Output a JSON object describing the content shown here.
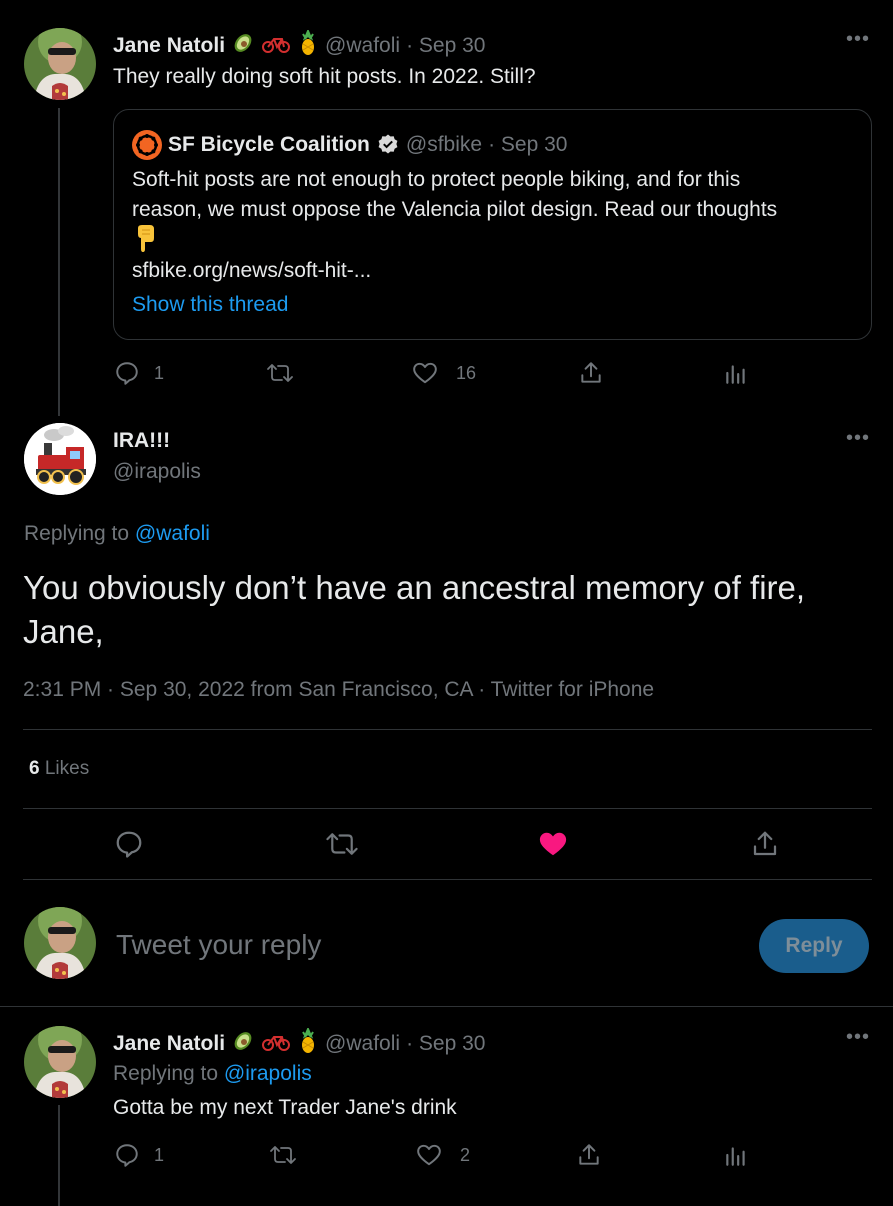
{
  "tweet1": {
    "name": "Jane Natoli",
    "handle": "@wafoli",
    "date": "· Sep 30",
    "text": "They really doing soft hit posts. In 2022. Still?",
    "quote": {
      "name": "SF Bicycle Coalition",
      "handle": "@sfbike",
      "date": "· Sep 30",
      "text_line1": "Soft-hit posts are not enough to protect people biking, and for this",
      "text_line2": "reason, we must oppose the Valencia pilot design. Read our thoughts",
      "link": "sfbike.org/news/soft-hit-...",
      "show_thread": "Show this thread"
    },
    "replies": "1",
    "likes": "16"
  },
  "main": {
    "name": "IRA!!!",
    "handle": "@irapolis",
    "replying_prefix": "Replying to ",
    "replying_handle": "@wafoli",
    "text_line1": "You obviously don’t have an ancestral memory of fire,",
    "text_line2": "Jane,",
    "meta": "2:31 PM · Sep 30, 2022 from San Francisco, CA · Twitter for iPhone",
    "likes_count": "6",
    "likes_label": " Likes"
  },
  "compose": {
    "placeholder": "Tweet your reply",
    "button": "Reply"
  },
  "tweet2": {
    "name": "Jane Natoli",
    "handle": "@wafoli",
    "date": "· Sep 30",
    "replying_prefix": "Replying to ",
    "replying_handle": "@irapolis",
    "text": "Gotta be my next Trader Jane's drink",
    "replies": "1",
    "likes": "2"
  },
  "colors": {
    "background": "#000000",
    "accent": "#1d9bf0",
    "liked": "#f91880",
    "reply_button": "#1a5d8c"
  }
}
